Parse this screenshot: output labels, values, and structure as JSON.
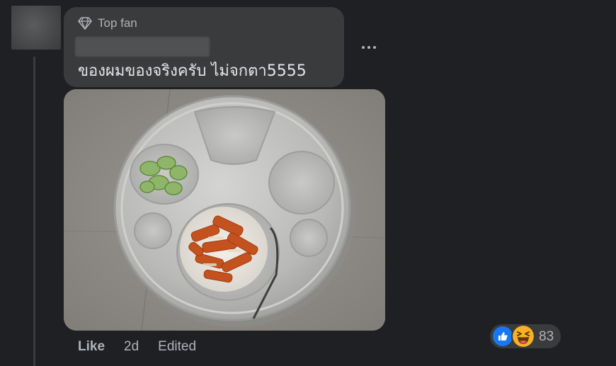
{
  "comment": {
    "badge_label": "Top fan",
    "text": "ของผมของจริงครับ ไม่จกตา5555"
  },
  "actions": {
    "like_label": "Like",
    "time": "2d",
    "edited_label": "Edited"
  },
  "reactions": {
    "count": "83",
    "types": [
      "like-icon",
      "haha-icon"
    ],
    "colors": {
      "like": "#1877f2",
      "haha": "#f7b125"
    }
  },
  "icons": {
    "badge": "diamond-icon",
    "menu": "more-dots-icon"
  }
}
